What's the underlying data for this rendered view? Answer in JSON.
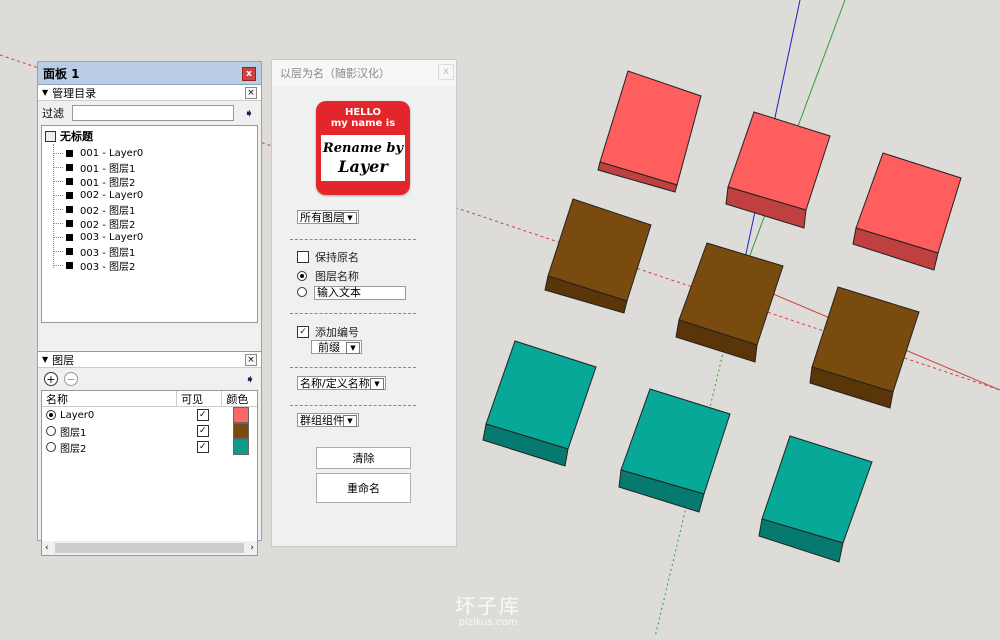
{
  "tray": {
    "title": "面板 1",
    "close": "x",
    "outliner": {
      "section_title": "管理目录",
      "filter_label": "过滤",
      "filter_value": "",
      "root": "无标题",
      "items": [
        "001 - Layer0",
        "001 - 图层1",
        "001 - 图层2",
        "002 - Layer0",
        "002 - 图层1",
        "002 - 图层2",
        "003 - Layer0",
        "003 - 图层1",
        "003 - 图层2"
      ]
    },
    "layers": {
      "section_title": "图层",
      "add": "+",
      "remove": "−",
      "col_name": "名称",
      "col_visible": "可见",
      "col_color": "颜色",
      "rows": [
        {
          "name": "Layer0",
          "active": true,
          "visible": "✓",
          "color": "#fe6665"
        },
        {
          "name": "图层1",
          "active": false,
          "visible": "✓",
          "color": "#7a4b0e"
        },
        {
          "name": "图层2",
          "active": false,
          "visible": "✓",
          "color": "#0f9d8b"
        }
      ],
      "scroll_left": "‹",
      "scroll_right": "›"
    }
  },
  "dialog": {
    "title": "以层为名（随影汉化）",
    "close": "x",
    "logo": {
      "hello": "HELLO",
      "name_is": "my name is",
      "line1": "Rename by",
      "line2": "Layer"
    },
    "scope_select": "所有图层",
    "keep_original": "保持原名",
    "layer_name": "图层名称",
    "custom_text": "输入文本",
    "custom_text_value": "输入文本",
    "add_number": "添加编号",
    "number_position": "前缀",
    "name_field": "名称/定义名称",
    "entity_type": "群组组件",
    "clear_button": "清除",
    "rename_button": "重命名"
  },
  "watermark": {
    "cn": "坏子库",
    "en": "pizikus.com"
  },
  "colors": {
    "red": "#fe5e5d",
    "brown": "#7a4b0e",
    "teal": "#07a897",
    "tray_title": "#b9cde5"
  }
}
